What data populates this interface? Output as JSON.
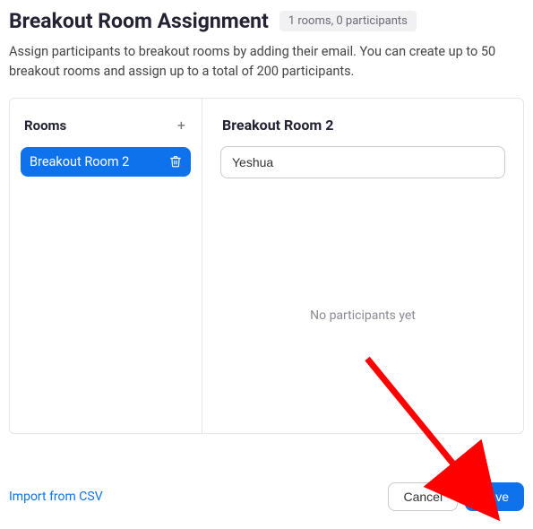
{
  "header": {
    "title": "Breakout Room Assignment",
    "badge": "1 rooms, 0 participants"
  },
  "description": "Assign participants to breakout rooms by adding their email. You can create up to 50 breakout rooms and assign up to a total of 200 participants.",
  "rooms_panel": {
    "label": "Rooms",
    "items": [
      {
        "name": "Breakout Room 2"
      }
    ]
  },
  "detail": {
    "title": "Breakout Room 2",
    "input_value": "Yeshua",
    "empty_text": "No participants yet"
  },
  "footer": {
    "import_label": "Import from CSV",
    "cancel_label": "Cancel",
    "save_label": "Save"
  }
}
